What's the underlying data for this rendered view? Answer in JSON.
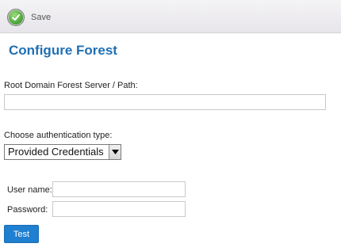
{
  "toolbar": {
    "save_label": "Save",
    "save_icon": "checkmark-icon"
  },
  "page": {
    "title": "Configure Forest"
  },
  "form": {
    "root_domain": {
      "label": "Root Domain Forest Server / Path:",
      "value": ""
    },
    "auth_type": {
      "label": "Choose authentication type:",
      "selected": "Provided Credentials"
    },
    "username": {
      "label": "User name:",
      "value": ""
    },
    "password": {
      "label": "Password:",
      "value": ""
    },
    "test_label": "Test"
  },
  "colors": {
    "title": "#1f6fb3",
    "button": "#1f7fd0",
    "toolbar": "#eeecf0"
  }
}
